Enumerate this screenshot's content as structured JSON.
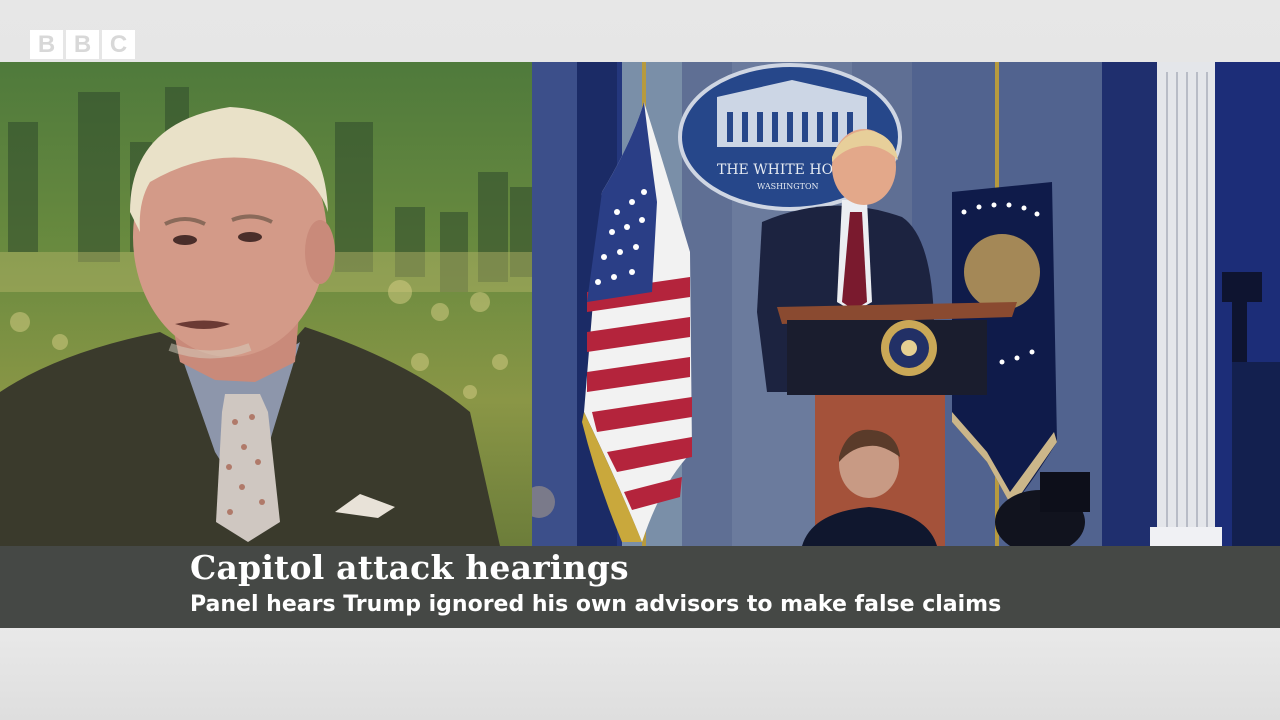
{
  "channel": {
    "logo_letters": [
      "B",
      "B",
      "C"
    ]
  },
  "left_feed": {
    "subject": "commentator-in-studio"
  },
  "right_feed": {
    "seal_line1": "THE WHITE HO",
    "seal_line2": "WASHINGTON"
  },
  "lower_third": {
    "headline": "Capitol attack hearings",
    "subline": "Panel hears Trump ignored his own advisors to make false claims"
  },
  "colors": {
    "lower_third_bg": "#454845",
    "background": "#e6e6e6",
    "press_room_blue": "#22357a"
  }
}
